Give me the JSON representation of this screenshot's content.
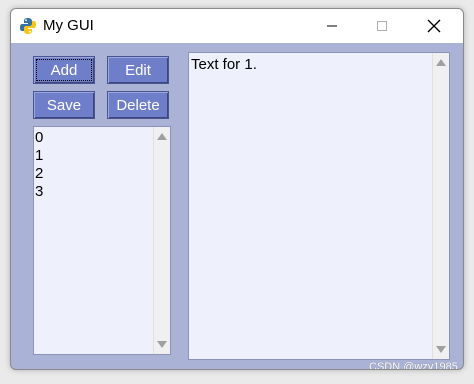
{
  "window": {
    "title": "My GUI",
    "background_color": "#aab2d6",
    "icon": "python-icon"
  },
  "titlebar_controls": {
    "minimize_icon": "minimize-icon",
    "maximize_icon": "maximize-icon",
    "close_icon": "close-icon"
  },
  "buttons": {
    "add_label": "Add",
    "edit_label": "Edit",
    "save_label": "Save",
    "delete_label": "Delete",
    "button_color": "#6f7ec9"
  },
  "listbox": {
    "items": [
      "0",
      "1",
      "2",
      "3"
    ]
  },
  "textbox": {
    "content": "Text for 1."
  },
  "watermark": {
    "text": "CSDN @wzy1985"
  }
}
